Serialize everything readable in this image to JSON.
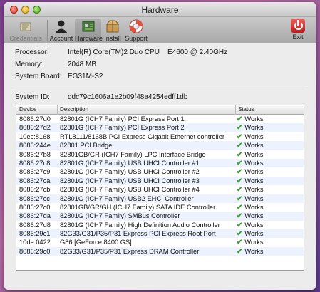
{
  "window": {
    "title": "Hardware"
  },
  "toolbar": {
    "credentials": "Credentials",
    "account": "Account",
    "hardware": "Hardware",
    "install": "Install",
    "support": "Support",
    "exit": "Exit"
  },
  "info": {
    "processor_label": "Processor:",
    "processor_value": "Intel(R) Core(TM)2 Duo CPU    E4600 @ 2.40GHz",
    "memory_label": "Memory:",
    "memory_value": "2048 MB",
    "board_label": "System Board:",
    "board_value": "EG31M-S2",
    "sysid_label": "System ID:",
    "sysid_value": "ddc79c1606a1e2b09f48a4254edff1db"
  },
  "table": {
    "headers": {
      "device": "Device",
      "description": "Description",
      "status": "Status"
    },
    "rows": [
      {
        "device": "8086:27d0",
        "description": "82801G (ICH7 Family) PCI Express Port 1",
        "status": "Works"
      },
      {
        "device": "8086:27d2",
        "description": "82801G (ICH7 Family) PCI Express Port 2",
        "status": "Works"
      },
      {
        "device": "10ec:8168",
        "description": "RTL8111/8168B PCI Express Gigabit Ethernet controller",
        "status": "Works"
      },
      {
        "device": "8086:244e",
        "description": "82801 PCI Bridge",
        "status": "Works"
      },
      {
        "device": "8086:27b8",
        "description": "82801GB/GR (ICH7 Family) LPC Interface Bridge",
        "status": "Works"
      },
      {
        "device": "8086:27c8",
        "description": "82801G (ICH7 Family) USB UHCI Controller #1",
        "status": "Works"
      },
      {
        "device": "8086:27c9",
        "description": "82801G (ICH7 Family) USB UHCI Controller #2",
        "status": "Works"
      },
      {
        "device": "8086:27ca",
        "description": "82801G (ICH7 Family) USB UHCI Controller #3",
        "status": "Works"
      },
      {
        "device": "8086:27cb",
        "description": "82801G (ICH7 Family) USB UHCI Controller #4",
        "status": "Works"
      },
      {
        "device": "8086:27cc",
        "description": "82801G (ICH7 Family) USB2 EHCI Controller",
        "status": "Works"
      },
      {
        "device": "8086:27c0",
        "description": "82801GB/GR/GH (ICH7 Family) SATA IDE Controller",
        "status": "Works"
      },
      {
        "device": "8086:27da",
        "description": "82801G (ICH7 Family) SMBus Controller",
        "status": "Works"
      },
      {
        "device": "8086:27d8",
        "description": "82801G (ICH7 Family) High Definition Audio Controller",
        "status": "Works"
      },
      {
        "device": "8086:29c1",
        "description": "82G33/G31/P35/P31 Express PCI Express Root Port",
        "status": "Works"
      },
      {
        "device": "10de:0422",
        "description": "G86 [GeForce 8400 GS]",
        "status": "Works"
      },
      {
        "device": "8086:29c0",
        "description": "82G33/G31/P35/P31 Express DRAM Controller",
        "status": "Works"
      }
    ]
  },
  "colors": {
    "check": "#3a9d2a",
    "row_alt": "#edf3fe"
  }
}
